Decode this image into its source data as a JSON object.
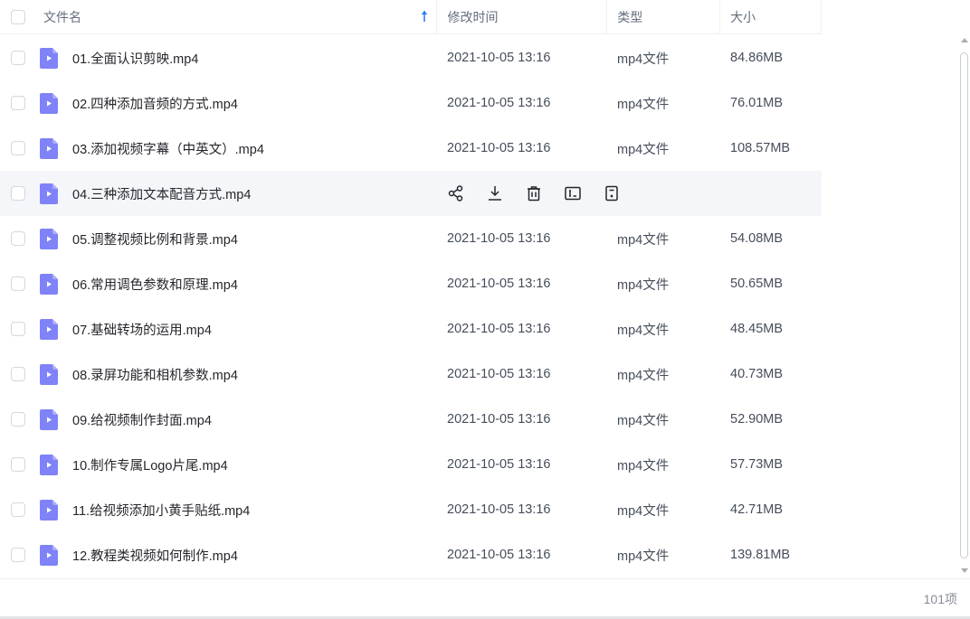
{
  "header": {
    "name": "文件名",
    "time": "修改时间",
    "type": "类型",
    "size": "大小"
  },
  "colors": {
    "file_icon": "#7f83f7",
    "sort_arrow": "#2f7cf6"
  },
  "files": [
    {
      "name": "01.全面认识剪映.mp4",
      "time": "2021-10-05 13:16",
      "type": "mp4文件",
      "size": "84.86MB"
    },
    {
      "name": "02.四种添加音频的方式.mp4",
      "time": "2021-10-05 13:16",
      "type": "mp4文件",
      "size": "76.01MB"
    },
    {
      "name": "03.添加视频字幕（中英文）.mp4",
      "time": "2021-10-05 13:16",
      "type": "mp4文件",
      "size": "108.57MB"
    },
    {
      "name": "04.三种添加文本配音方式.mp4",
      "time": "",
      "type": "",
      "size": ""
    },
    {
      "name": "05.调整视频比例和背景.mp4",
      "time": "2021-10-05 13:16",
      "type": "mp4文件",
      "size": "54.08MB"
    },
    {
      "name": "06.常用调色参数和原理.mp4",
      "time": "2021-10-05 13:16",
      "type": "mp4文件",
      "size": "50.65MB"
    },
    {
      "name": "07.基础转场的运用.mp4",
      "time": "2021-10-05 13:16",
      "type": "mp4文件",
      "size": "48.45MB"
    },
    {
      "name": "08.录屏功能和相机参数.mp4",
      "time": "2021-10-05 13:16",
      "type": "mp4文件",
      "size": "40.73MB"
    },
    {
      "name": "09.给视频制作封面.mp4",
      "time": "2021-10-05 13:16",
      "type": "mp4文件",
      "size": "52.90MB"
    },
    {
      "name": "10.制作专属Logo片尾.mp4",
      "time": "2021-10-05 13:16",
      "type": "mp4文件",
      "size": "57.73MB"
    },
    {
      "name": "11.给视频添加小黄手贴纸.mp4",
      "time": "2021-10-05 13:16",
      "type": "mp4文件",
      "size": "42.71MB"
    },
    {
      "name": "12.教程类视频如何制作.mp4",
      "time": "2021-10-05 13:16",
      "type": "mp4文件",
      "size": "139.81MB"
    }
  ],
  "hover_actions": [
    "share-icon",
    "download-icon",
    "delete-icon",
    "rename-icon",
    "more-icon"
  ],
  "footer": {
    "count": "101项"
  }
}
